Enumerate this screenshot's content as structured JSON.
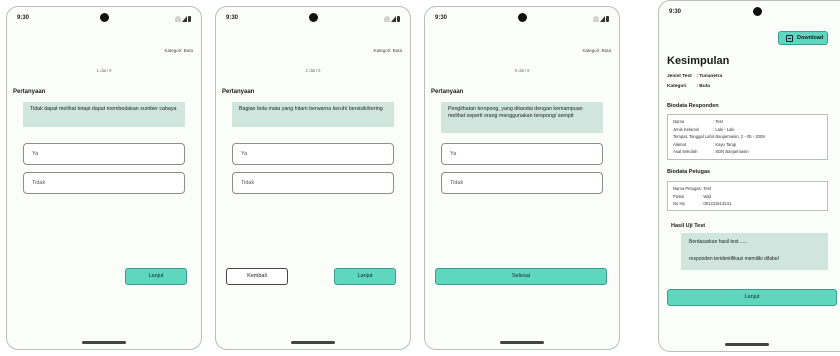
{
  "status": {
    "time": "9:30"
  },
  "kategori_label": "Kategori: Buta",
  "question_heading": "Pertanyaan",
  "options": [
    "Ya",
    "Tidak"
  ],
  "screens": [
    {
      "counter": "1 dari 9",
      "question": "Tidak dapat melihat tetapi dapat membedakan sumber cahaya",
      "primary_button": "Lanjut",
      "secondary_button": ""
    },
    {
      "counter": "2 dari 9",
      "question": "Bagian bola mata yang hitam berwarna keruh/ bersisik/kering",
      "primary_button": "Lanjut",
      "secondary_button": "Kembali"
    },
    {
      "counter": "9 dari 9",
      "question": "Penglihatan teropong, yang ditandai dengan kemampuan melihat seperti orang menggunakan teropong/ sempit",
      "primary_button": "Selesai",
      "secondary_button": ""
    }
  ],
  "summary": {
    "download_label": "Download",
    "title": "Kesimpulan",
    "jenis_test": {
      "key": "Jenist Test",
      "value": ": Tunanetra"
    },
    "kategori": {
      "key": "Kategori",
      "value": ": Buta"
    },
    "responden_title": "Biodata Responden",
    "responden": [
      {
        "key": "Nama",
        "value": ": Test"
      },
      {
        "key": "Jenis Kelamin",
        "value": ": Laki - Laki"
      },
      {
        "key": "Tempat, Tanggal Lahir",
        "value": ": Banjarmasin, 2 - 05 - 2009"
      },
      {
        "key": "Alamat",
        "value": ": Kayu Tangi"
      },
      {
        "key": "Asal Sekolah",
        "value": ": SDN Banjarmasin"
      }
    ],
    "petugas_title": "Biodata Petugas",
    "petugas": [
      {
        "key": "Nama Petugas",
        "value": ": Test"
      },
      {
        "key": "Posisi",
        "value": ": Wali"
      },
      {
        "key": "No Hp",
        "value": ": 081231513131"
      }
    ],
    "hasil_title": "Hasil Uji Test",
    "hasil_line1": "Berdasarkan hasil test .....",
    "hasil_line2": "responden teridentifikasi memiliki difabel",
    "lanjut_label": "Lanjut"
  }
}
